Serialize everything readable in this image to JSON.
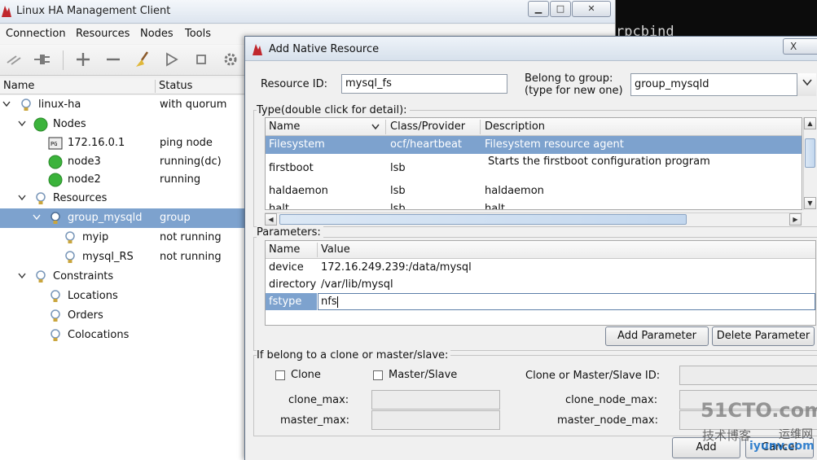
{
  "terminal": {
    "text": "rpcbind"
  },
  "main": {
    "title": "Linux HA Management Client",
    "menus": [
      "Connection",
      "Resources",
      "Nodes",
      "Tools"
    ],
    "toolbar_icons": [
      "disconnect-icon",
      "connect-icon",
      "add-icon",
      "remove-icon",
      "cleanup-broom-icon",
      "start-icon",
      "stop-icon",
      "settings-gear-icon"
    ],
    "tree_header": {
      "name": "Name",
      "status": "Status"
    },
    "tree": [
      {
        "name": "linux-ha",
        "status": "with quorum",
        "icon": "bulb-icon"
      },
      {
        "name": "Nodes",
        "status": "",
        "icon": "green-dot-icon"
      },
      {
        "name": "172.16.0.1",
        "status": "ping node",
        "icon": "ping-node-icon"
      },
      {
        "name": "node3",
        "status": "running(dc)",
        "icon": "green-dot-icon"
      },
      {
        "name": "node2",
        "status": "running",
        "icon": "green-dot-icon"
      },
      {
        "name": "Resources",
        "status": "",
        "icon": "bulb-icon"
      },
      {
        "name": "group_mysqld",
        "status": "group",
        "icon": "bulb-icon"
      },
      {
        "name": "myip",
        "status": "not running",
        "icon": "bulb-icon"
      },
      {
        "name": "mysql_RS",
        "status": "not running",
        "icon": "bulb-icon"
      },
      {
        "name": "Constraints",
        "status": "",
        "icon": "bulb-icon"
      },
      {
        "name": "Locations",
        "status": "",
        "icon": "bulb-icon"
      },
      {
        "name": "Orders",
        "status": "",
        "icon": "bulb-icon"
      },
      {
        "name": "Colocations",
        "status": "",
        "icon": "bulb-icon"
      }
    ]
  },
  "dialog": {
    "title": "Add Native Resource",
    "close_label": "X",
    "resource_id_label": "Resource ID:",
    "resource_id_value": "mysql_fs",
    "group_label_1": "Belong to group:",
    "group_label_2": "(type for new one)",
    "group_value": "group_mysqld",
    "type_title": "Type(double click for detail):",
    "type_columns": [
      "Name",
      "Class/Provider",
      "Description"
    ],
    "type_rows": [
      {
        "name": "Filesystem",
        "cls": "ocf/heartbeat",
        "desc": "Filesystem resource agent"
      },
      {
        "name": "firstboot",
        "cls": "lsb",
        "desc": "Starts the firstboot configuration program"
      },
      {
        "name": "haldaemon",
        "cls": "lsb",
        "desc": "haldaemon"
      },
      {
        "name": "halt",
        "cls": "lsb",
        "desc": "halt"
      }
    ],
    "params_title": "Parameters:",
    "params_columns": [
      "Name",
      "Value"
    ],
    "params_rows": [
      {
        "name": "device",
        "value": "172.16.249.239:/data/mysql"
      },
      {
        "name": "directory",
        "value": "/var/lib/mysql"
      },
      {
        "name": "fstype",
        "value": "nfs"
      }
    ],
    "add_param_label": "Add Parameter",
    "delete_param_label": "Delete Parameter",
    "clone_title": "If belong to a clone or master/slave:",
    "clone_label": "Clone",
    "masterslave_label": "Master/Slave",
    "clone_id_label": "Clone or Master/Slave ID:",
    "clone_max_label": "clone_max:",
    "clone_node_max_label": "clone_node_max:",
    "master_max_label": "master_max:",
    "master_node_max_label": "master_node_max:",
    "add_label": "Add",
    "cancel_label": "Cancel"
  },
  "watermark": {
    "line1": "51CTO.com",
    "line2": "技术博客",
    "line3": "运维网",
    "line4": "iyunv.com"
  }
}
